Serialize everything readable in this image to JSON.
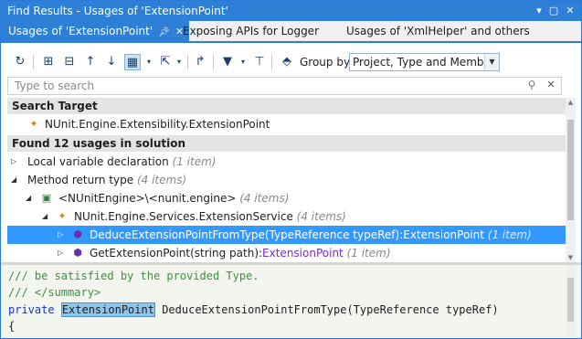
{
  "window": {
    "title": "Find Results - Usages of 'ExtensionPoint'",
    "colors": {
      "accent": "#2e7fd6",
      "selection": "#3399ff",
      "purple": "#7f2ec6",
      "comment": "#3f8f3f"
    }
  },
  "tabs": [
    {
      "label": "Usages of 'ExtensionPoint'",
      "active": true
    },
    {
      "label": "Exposing APIs for Logger",
      "active": false
    },
    {
      "label": "Usages of 'XmlHelper' and others",
      "active": false
    }
  ],
  "toolbar": {
    "group_by_label": "Group by:",
    "group_by_value": "Project, Type and Member",
    "icons": [
      "refresh-icon",
      "expand-all-icon",
      "collapse-all-icon",
      "previous-icon",
      "next-icon",
      "preview-icon",
      "export-icon",
      "merge-icon",
      "filter-icon",
      "pin-results-icon",
      "show-in-icon"
    ]
  },
  "search": {
    "placeholder": "Type to search"
  },
  "tree": {
    "search_target_header": "Search Target",
    "target_name": "NUnit.Engine.Extensibility.ExtensionPoint",
    "found_header": "Found 12 usages in solution",
    "rows": [
      {
        "label": "Local variable declaration",
        "count": "(1 item)"
      },
      {
        "label": "Method return type",
        "count": "(4 items)"
      },
      {
        "label": "<NUnitEngine>\\<nunit.engine>",
        "count": "(4 items)"
      },
      {
        "label": "NUnit.Engine.Services.ExtensionService",
        "count": "(4 items)"
      },
      {
        "label": "DeduceExtensionPointFromType(TypeReference typeRef):ExtensionPoint",
        "count": "(1 item)",
        "selected": true
      },
      {
        "label_prefix": "GetExtensionPoint(string path):",
        "label_type": "ExtensionPoint",
        "count": "(1 item)"
      }
    ]
  },
  "code": {
    "line1": "/// be satisfied by the provided Type.",
    "line2": "/// </summary>",
    "line3_kw": "private",
    "line3_hl": "ExtensionPoint",
    "line3_rest": " DeduceExtensionPointFromType(TypeReference typeRef)",
    "line4": "{"
  }
}
